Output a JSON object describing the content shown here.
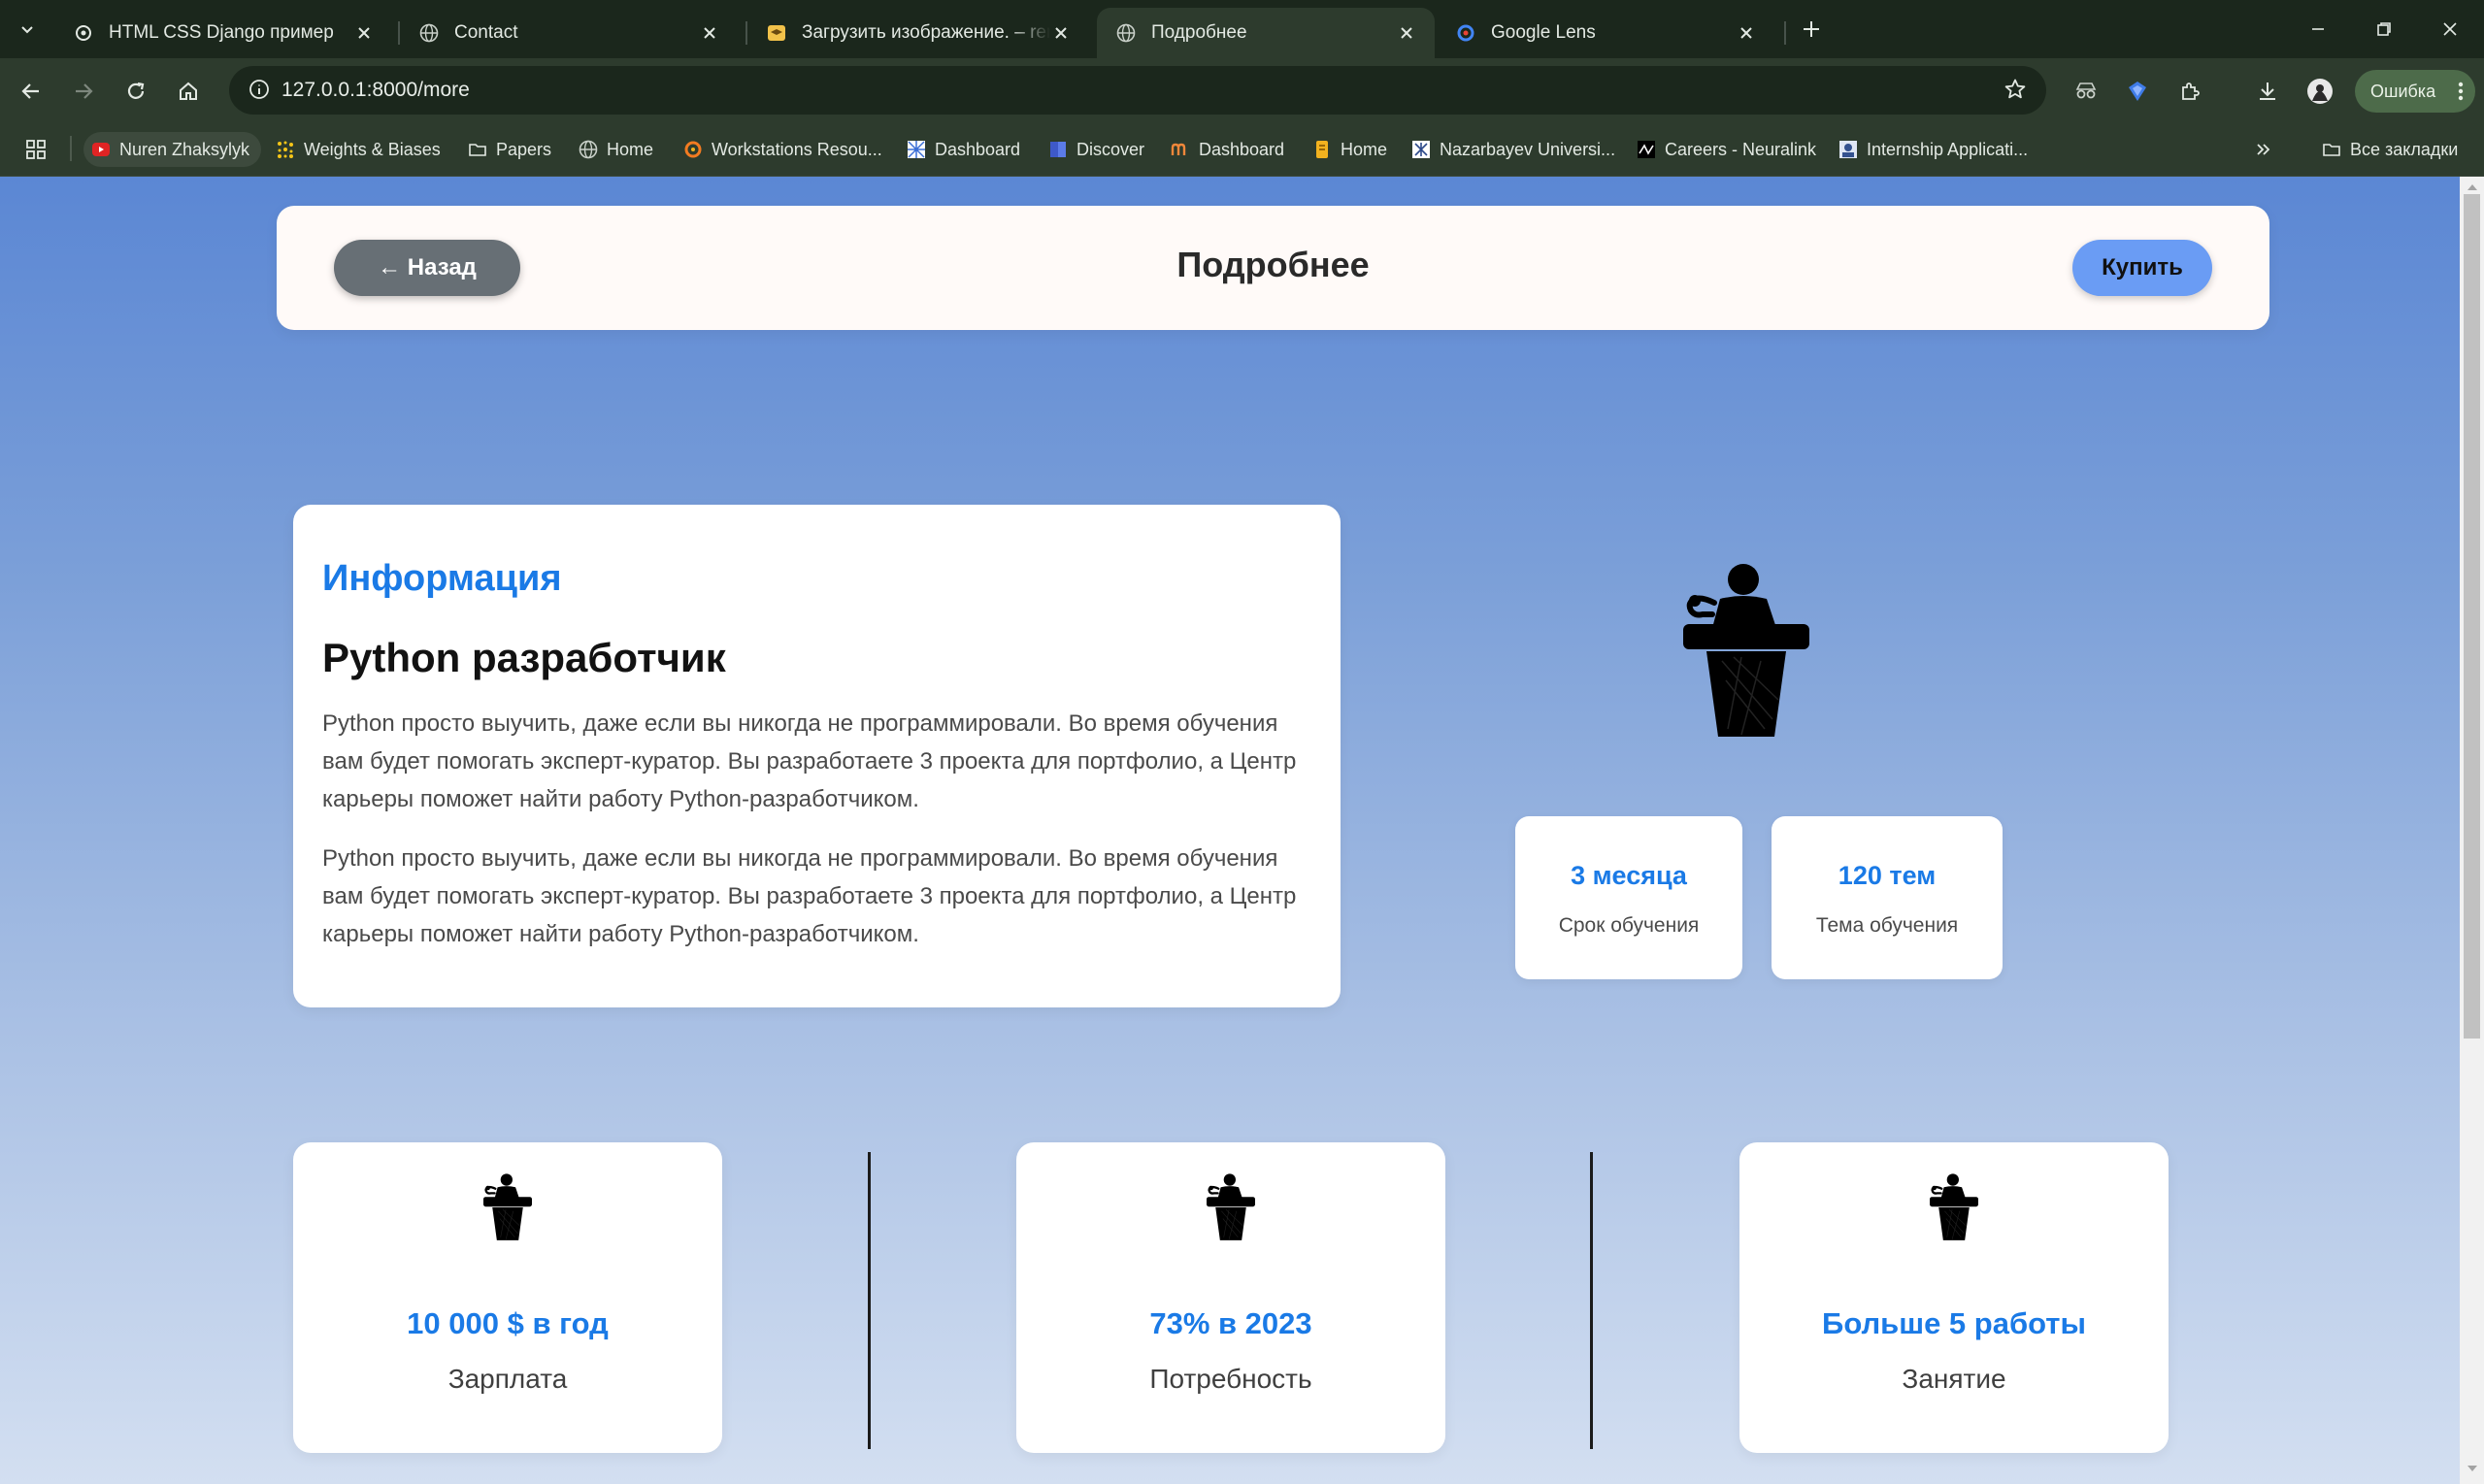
{
  "browser": {
    "tabs": [
      {
        "title": "HTML CSS Django пример",
        "icon": "openai-icon",
        "active": false
      },
      {
        "title": "Contact",
        "icon": "globe-icon",
        "active": false
      },
      {
        "title": "Загрузить изображение. – rem",
        "icon": "graduation-cap-icon",
        "active": false
      },
      {
        "title": "Подробнее",
        "icon": "globe-icon",
        "active": true
      },
      {
        "title": "Google Lens",
        "icon": "google-lens-icon",
        "active": false
      }
    ],
    "url": "127.0.0.1:8000/more",
    "profile_status": "Ошибка",
    "bookmarks": [
      {
        "label": "Nuren Zhaksylyk",
        "icon": "youtube-icon"
      },
      {
        "label": "Weights & Biases",
        "icon": "wandb-icon"
      },
      {
        "label": "Papers",
        "icon": "folder-icon"
      },
      {
        "label": "Home",
        "icon": "globe-icon"
      },
      {
        "label": "Workstations Resou...",
        "icon": "grafana-icon"
      },
      {
        "label": "Dashboard",
        "icon": "dashboard-icon"
      },
      {
        "label": "Discover",
        "icon": "discover-icon"
      },
      {
        "label": "Dashboard",
        "icon": "m-icon"
      },
      {
        "label": "Home",
        "icon": "bookmark-icon"
      },
      {
        "label": "Nazarbayev Universi...",
        "icon": "nu-icon"
      },
      {
        "label": "Careers - Neuralink",
        "icon": "neuralink-icon"
      },
      {
        "label": "Internship Applicati...",
        "icon": "internship-icon"
      }
    ],
    "all_bookmarks": "Все закладки",
    "colors": {
      "frame": "#1b271c",
      "toolbar": "#2d3b2d",
      "accent_blue": "#1a7ae6",
      "buy_button": "#6a9cf4",
      "back_button": "#676f75"
    }
  },
  "page": {
    "header": {
      "back_label": "← Назад",
      "title": "Подробнее",
      "buy_label": "Купить"
    },
    "info": {
      "heading": "Информация",
      "subtitle": "Python разработчик",
      "paragraphs": [
        "Python просто выучить, даже если вы никогда не программировали. Во время обучения вам будет помогать эксперт-куратор. Вы разработаете 3 проекта для портфолио, а Центр карьеры поможет найти работу Python-разработчиком.",
        "Python просто выучить, даже если вы никогда не программировали. Во время обучения вам будет помогать эксперт-куратор. Вы разработаете 3 проекта для портфолио, а Центр карьеры поможет найти работу Python-разработчиком."
      ]
    },
    "stats": [
      {
        "value": "3 месяца",
        "label": "Срок обучения"
      },
      {
        "value": "120 тем",
        "label": "Тема обучения"
      }
    ],
    "features": [
      {
        "value": "10 000 $ в год",
        "label": "Зарплата",
        "icon": "speaker-podium-icon"
      },
      {
        "value": "73% в 2023",
        "label": "Потребность",
        "icon": "speaker-podium-icon"
      },
      {
        "value": "Больше 5 работы",
        "label": "Занятие",
        "icon": "speaker-podium-icon"
      }
    ]
  }
}
